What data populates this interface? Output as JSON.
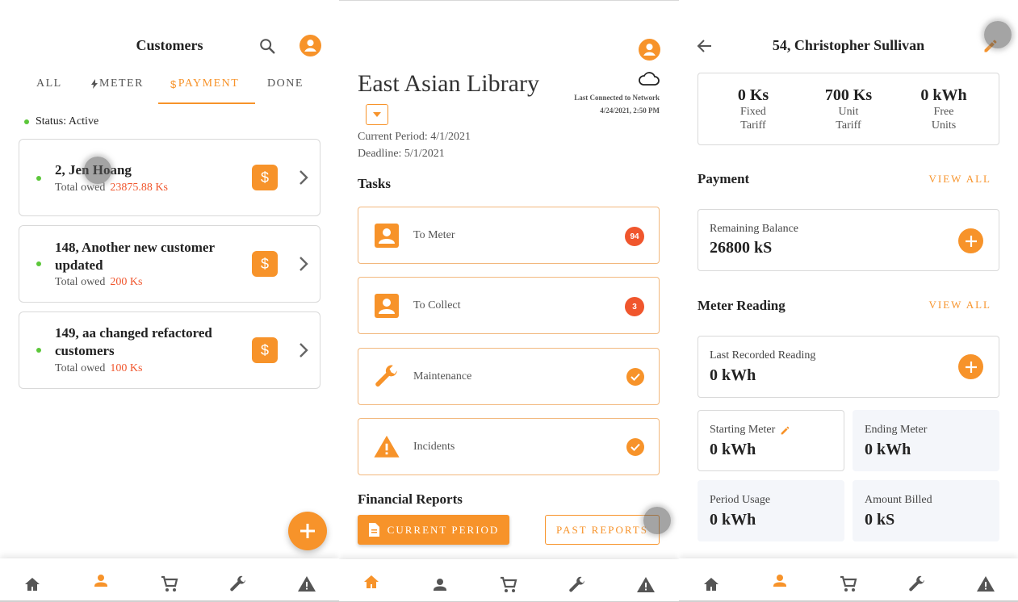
{
  "customers": {
    "title": "Customers",
    "tabs": [
      {
        "label": "ALL"
      },
      {
        "label": "METER"
      },
      {
        "label": "PAYMENT"
      },
      {
        "label": "DONE"
      }
    ],
    "status": "Status: Active",
    "owed_label": "Total owed",
    "list": [
      {
        "name": "2, Jen Hoang",
        "owed": "23875.88 Ks"
      },
      {
        "name": "148, Another new customer updated",
        "owed": "200 Ks"
      },
      {
        "name": "149, aa changed refactored customers",
        "owed": "100 Ks"
      }
    ]
  },
  "dashboard": {
    "title": "East Asian Library",
    "last_connected_label": "Last Connected to Network",
    "last_connected_time": "4/24/2021, 2:50 PM",
    "current_period": "Current Period: 4/1/2021",
    "deadline": "Deadline: 5/1/2021",
    "tasks_heading": "Tasks",
    "tasks": [
      {
        "label": "To Meter",
        "count": "94"
      },
      {
        "label": "To Collect",
        "count": "3"
      },
      {
        "label": "Maintenance"
      },
      {
        "label": "Incidents"
      }
    ],
    "reports_heading": "Financial Reports",
    "current_period_button": "CURRENT PERIOD",
    "past_reports_button": "PAST REPORTS"
  },
  "detail": {
    "title": "54, Christopher Sullivan",
    "stats": [
      {
        "value": "0 Ks",
        "label1": "Fixed",
        "label2": "Tariff"
      },
      {
        "value": "700 Ks",
        "label1": "Unit",
        "label2": "Tariff"
      },
      {
        "value": "0 kWh",
        "label1": "Free",
        "label2": "Units"
      }
    ],
    "payment_heading": "Payment",
    "view_all": "VIEW ALL",
    "remaining_label": "Remaining Balance",
    "remaining_value": "26800 kS",
    "meter_heading": "Meter Reading",
    "last_reading_label": "Last Recorded Reading",
    "last_reading_value": "0 kWh",
    "starting_label": "Starting Meter",
    "starting_value": "0 kWh",
    "ending_label": "Ending Meter",
    "ending_value": "0 kWh",
    "usage_label": "Period Usage",
    "usage_value": "0 kWh",
    "billed_label": "Amount Billed",
    "billed_value": "0 kS"
  },
  "colors": {
    "accent": "#f7932a",
    "alert": "#f0562d",
    "active": "#5cc73a"
  },
  "icons": [
    "search-icon",
    "account-icon",
    "bolt-icon",
    "dollar-icon",
    "chevron-right-icon",
    "plus-icon",
    "home-icon",
    "person-icon",
    "cart-icon",
    "wrench-icon",
    "warning-icon",
    "cloud-icon",
    "dropdown-icon",
    "check-icon",
    "document-icon",
    "back-arrow-icon",
    "pencil-icon"
  ]
}
